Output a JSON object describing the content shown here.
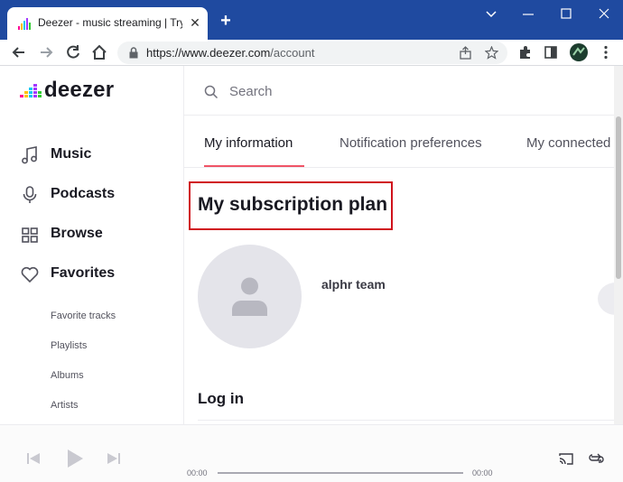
{
  "browser": {
    "tab_title": "Deezer - music streaming | Try Fl",
    "url_host": "https://www.deezer.com",
    "url_path": "/account",
    "new_tab": "+",
    "tab_close": "✕"
  },
  "brand": {
    "logo": "deezer"
  },
  "sidebar": {
    "nav": [
      {
        "label": "Music",
        "icon": "music-note-icon"
      },
      {
        "label": "Podcasts",
        "icon": "microphone-icon"
      },
      {
        "label": "Browse",
        "icon": "grid-icon"
      },
      {
        "label": "Favorites",
        "icon": "heart-icon"
      }
    ],
    "favorites": [
      "Favorite tracks",
      "Playlists",
      "Albums",
      "Artists"
    ]
  },
  "search": {
    "placeholder": "Search"
  },
  "tabs": [
    "My information",
    "Notification preferences",
    "My connected"
  ],
  "main": {
    "section_title": "My subscription plan",
    "username": "alphr team",
    "login_title": "Log in"
  },
  "player": {
    "time_current": "00:00",
    "time_total": "00:00",
    "progress": 0
  },
  "colors": {
    "chrome": "#1f4aa0",
    "accent": "#ef5466",
    "highlight": "#d0121b"
  }
}
